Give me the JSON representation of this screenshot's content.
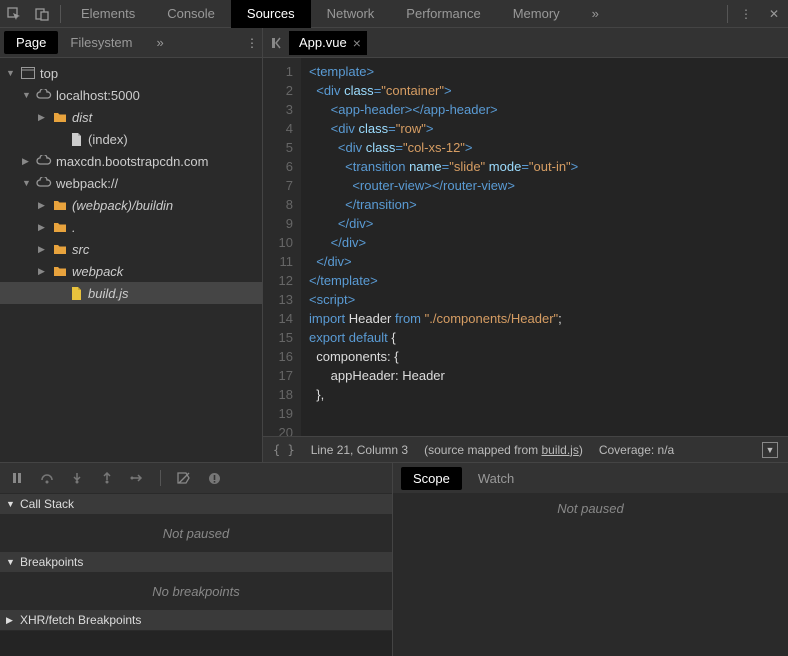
{
  "topbar": {
    "tabs": [
      "Elements",
      "Console",
      "Sources",
      "Network",
      "Performance",
      "Memory"
    ],
    "active": 2
  },
  "sidebar": {
    "tabs": [
      "Page",
      "Filesystem"
    ],
    "active": 0,
    "tree": [
      {
        "indent": 0,
        "arrow": "▼",
        "icon": "window",
        "label": "top",
        "italic": false
      },
      {
        "indent": 1,
        "arrow": "▼",
        "icon": "cloud",
        "label": "localhost:5000",
        "italic": false
      },
      {
        "indent": 2,
        "arrow": "▶",
        "icon": "folder",
        "label": "dist",
        "italic": true
      },
      {
        "indent": 3,
        "arrow": "",
        "icon": "file",
        "label": "(index)",
        "italic": false
      },
      {
        "indent": 1,
        "arrow": "▶",
        "icon": "cloud",
        "label": "maxcdn.bootstrapcdn.com",
        "italic": false
      },
      {
        "indent": 1,
        "arrow": "▼",
        "icon": "cloud",
        "label": "webpack://",
        "italic": false
      },
      {
        "indent": 2,
        "arrow": "▶",
        "icon": "folder",
        "label": "(webpack)/buildin",
        "italic": true
      },
      {
        "indent": 2,
        "arrow": "▶",
        "icon": "folder",
        "label": ".",
        "italic": true
      },
      {
        "indent": 2,
        "arrow": "▶",
        "icon": "folder",
        "label": "src",
        "italic": true
      },
      {
        "indent": 2,
        "arrow": "▶",
        "icon": "folder",
        "label": "webpack",
        "italic": true
      },
      {
        "indent": 3,
        "arrow": "",
        "icon": "file-js",
        "label": "build.js",
        "italic": true,
        "selected": true
      }
    ]
  },
  "editor": {
    "tab": "App.vue",
    "lines": [
      [
        {
          "c": "t-tag",
          "t": "<template>"
        }
      ],
      [
        {
          "c": "t-plain",
          "t": "  "
        },
        {
          "c": "t-tag",
          "t": "<div "
        },
        {
          "c": "t-attr",
          "t": "class"
        },
        {
          "c": "t-tag",
          "t": "="
        },
        {
          "c": "t-str",
          "t": "\"container\""
        },
        {
          "c": "t-tag",
          "t": ">"
        }
      ],
      [
        {
          "c": "t-plain",
          "t": "      "
        },
        {
          "c": "t-tag",
          "t": "<app-header></app-header>"
        }
      ],
      [
        {
          "c": "t-plain",
          "t": "      "
        },
        {
          "c": "t-tag",
          "t": "<div "
        },
        {
          "c": "t-attr",
          "t": "class"
        },
        {
          "c": "t-tag",
          "t": "="
        },
        {
          "c": "t-str",
          "t": "\"row\""
        },
        {
          "c": "t-tag",
          "t": ">"
        }
      ],
      [
        {
          "c": "t-plain",
          "t": "        "
        },
        {
          "c": "t-tag",
          "t": "<div "
        },
        {
          "c": "t-attr",
          "t": "class"
        },
        {
          "c": "t-tag",
          "t": "="
        },
        {
          "c": "t-str",
          "t": "\"col-xs-12\""
        },
        {
          "c": "t-tag",
          "t": ">"
        }
      ],
      [
        {
          "c": "t-plain",
          "t": "          "
        },
        {
          "c": "t-tag",
          "t": "<transition "
        },
        {
          "c": "t-attr",
          "t": "name"
        },
        {
          "c": "t-tag",
          "t": "="
        },
        {
          "c": "t-str",
          "t": "\"slide\""
        },
        {
          "c": "t-tag",
          "t": " "
        },
        {
          "c": "t-attr",
          "t": "mode"
        },
        {
          "c": "t-tag",
          "t": "="
        },
        {
          "c": "t-str",
          "t": "\"out-in\""
        },
        {
          "c": "t-tag",
          "t": ">"
        }
      ],
      [
        {
          "c": "t-plain",
          "t": "            "
        },
        {
          "c": "t-tag",
          "t": "<router-view></router-view>"
        }
      ],
      [
        {
          "c": "t-plain",
          "t": "          "
        },
        {
          "c": "t-tag",
          "t": "</transition>"
        }
      ],
      [
        {
          "c": "t-plain",
          "t": "        "
        },
        {
          "c": "t-tag",
          "t": "</div>"
        }
      ],
      [
        {
          "c": "t-plain",
          "t": "      "
        },
        {
          "c": "t-tag",
          "t": "</div>"
        }
      ],
      [
        {
          "c": "t-plain",
          "t": "  "
        },
        {
          "c": "t-tag",
          "t": "</div>"
        }
      ],
      [
        {
          "c": "t-tag",
          "t": "</template>"
        }
      ],
      [
        {
          "c": "t-plain",
          "t": ""
        }
      ],
      [
        {
          "c": "t-tag",
          "t": "<script>"
        }
      ],
      [
        {
          "c": "t-kw",
          "t": "import"
        },
        {
          "c": "t-plain",
          "t": " Header "
        },
        {
          "c": "t-kw",
          "t": "from"
        },
        {
          "c": "t-plain",
          "t": " "
        },
        {
          "c": "t-str",
          "t": "\"./components/Header\""
        },
        {
          "c": "t-plain",
          "t": ";"
        }
      ],
      [
        {
          "c": "t-plain",
          "t": ""
        }
      ],
      [
        {
          "c": "t-kw",
          "t": "export default"
        },
        {
          "c": "t-plain",
          "t": " {"
        }
      ],
      [
        {
          "c": "t-plain",
          "t": "  components: {"
        }
      ],
      [
        {
          "c": "t-plain",
          "t": "      appHeader: Header"
        }
      ],
      [
        {
          "c": "t-plain",
          "t": "  },"
        }
      ]
    ]
  },
  "statusbar": {
    "position": "Line 21, Column 3",
    "mapped_prefix": "(source mapped from ",
    "mapped_link": "build.js",
    "mapped_suffix": ")",
    "coverage": "Coverage: n/a"
  },
  "debug": {
    "sections": [
      {
        "title": "Call Stack",
        "body": "Not paused",
        "expanded": true
      },
      {
        "title": "Breakpoints",
        "body": "No breakpoints",
        "expanded": true
      },
      {
        "title": "XHR/fetch Breakpoints",
        "body": "",
        "expanded": false
      }
    ],
    "scope_tabs": [
      "Scope",
      "Watch"
    ],
    "scope_active": 0,
    "scope_body": "Not paused"
  }
}
